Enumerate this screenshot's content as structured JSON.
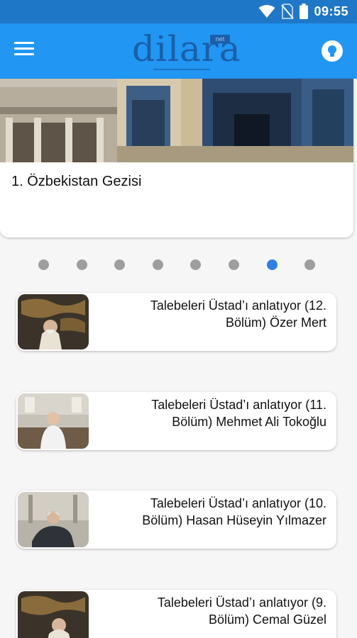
{
  "status_bar": {
    "time": "09:55",
    "icons": [
      "wifi-icon",
      "no-sim-icon",
      "battery-icon"
    ]
  },
  "app_bar": {
    "logo_text": "dilara",
    "logo_badge": "net",
    "icons": [
      "hamburger-menu-icon",
      "lightbulb-icon"
    ]
  },
  "carousel": {
    "slide_title": "1. Özbekistan Gezisi",
    "dot_count": 8,
    "active_dot": 7
  },
  "articles": [
    {
      "title": "Talebeleri Üstad’ı anlatıyor (12.\nBölüm) Özer Mert"
    },
    {
      "title": "Talebeleri Üstad’ı anlatıyor (11.\nBölüm)   Mehmet Ali Tokoğlu"
    },
    {
      "title": "Talebeleri Üstad’ı anlatıyor (10.\nBölüm)   Hasan Hüseyin Yılmazer"
    },
    {
      "title": "Talebeleri Üstad’ı anlatıyor (9.\nBölüm)  Cemal Güzel"
    }
  ],
  "colors": {
    "status_bar": "#1f77c7",
    "app_bar": "#2196f3",
    "logo": "#1b5fa8",
    "active_dot": "#2f7fe6",
    "inactive_dot": "#9e9e9e"
  }
}
